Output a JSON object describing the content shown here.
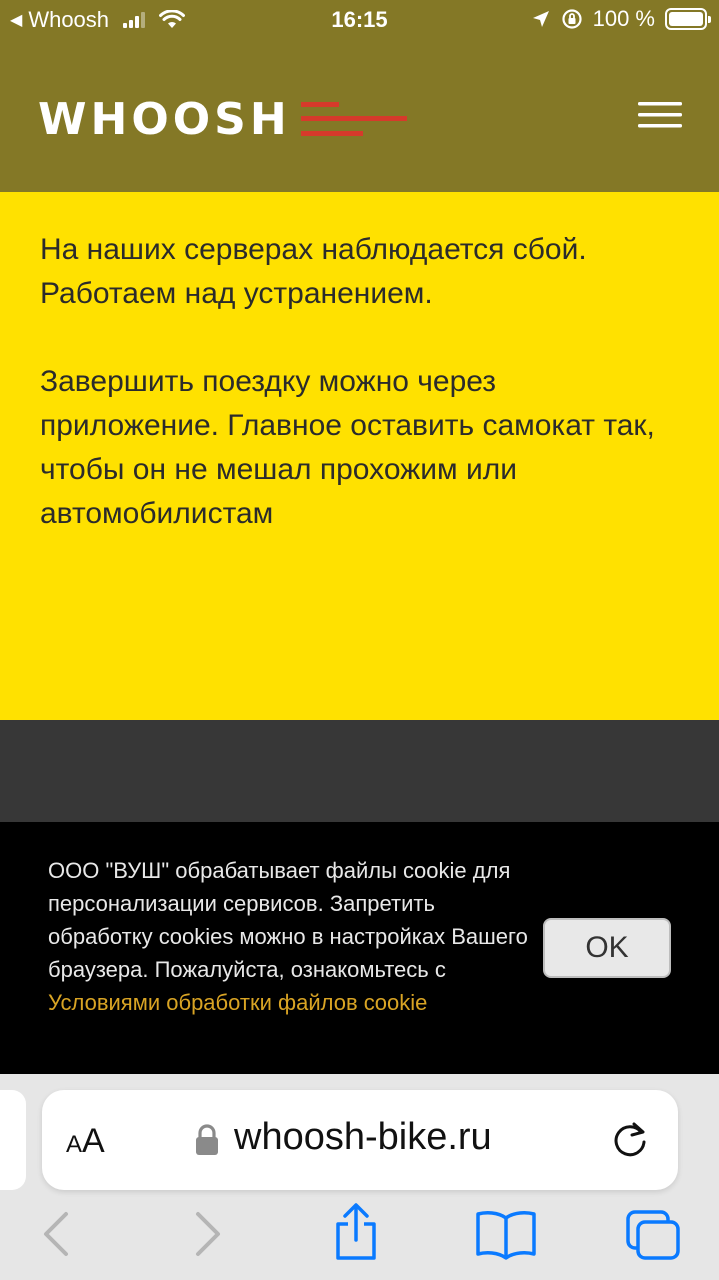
{
  "status_bar": {
    "back_app": "Whoosh",
    "time": "16:15",
    "battery": "100 %"
  },
  "header": {
    "logo_text": "WHOOSH",
    "logo_accent_color": "#d63a2b",
    "background": "#847826"
  },
  "message": {
    "paragraph1": "На наших серверах наблюдается сбой. Работаем над устранением.",
    "paragraph2": "Завершить поездку можно через приложение. Главное оставить самокат так, чтобы он не мешал прохожим или автомобилистам",
    "background": "#ffe100"
  },
  "cookie_banner": {
    "text": "ООО \"ВУШ\" обрабатывает файлы cookie для персонализации сервисов. Запретить обработку cookies можно в настройках Вашего браузера. Пожалуйста, ознакомьтесь с ",
    "link_text": "Условиями обработки файлов cookie",
    "ok_label": "OK",
    "link_color": "#d9a424"
  },
  "browser": {
    "aa_label_small": "A",
    "aa_label_large": "A",
    "url": "whoosh-bike.ru",
    "accent": "#0a7aff"
  }
}
